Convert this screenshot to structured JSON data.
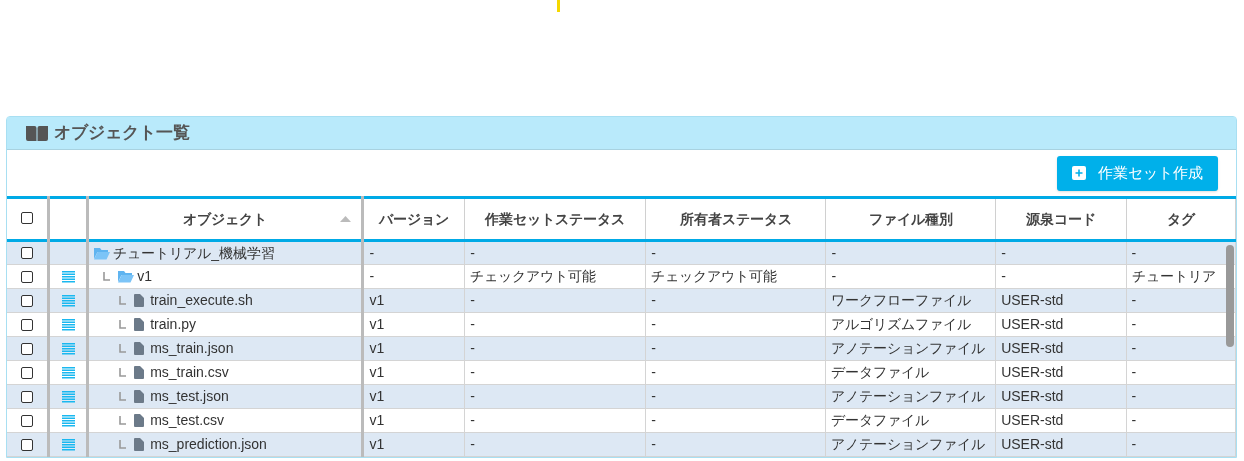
{
  "panel": {
    "title": "オブジェクト一覧"
  },
  "toolbar": {
    "create_button": "作業セット作成"
  },
  "table": {
    "select_all": {
      "checked": false
    },
    "columns": [
      {
        "label": "オブジェクト",
        "sortable": true
      },
      {
        "label": "バージョン",
        "sortable": false
      },
      {
        "label": "作業セットステータス",
        "sortable": false
      },
      {
        "label": "所有者ステータス",
        "sortable": false
      },
      {
        "label": "ファイル種別",
        "sortable": false
      },
      {
        "label": "源泉コード",
        "sortable": false
      },
      {
        "label": "タグ",
        "sortable": false
      }
    ],
    "rows": [
      {
        "kind": "folder",
        "checked": false,
        "menu": false,
        "cells": [
          "チュートリアル_機械学習",
          "-",
          "-",
          "-",
          "-",
          "-",
          "-"
        ],
        "children": [
          {
            "kind": "folder",
            "checked": false,
            "menu": true,
            "cells": [
              "v1",
              "-",
              "チェックアウト可能",
              "チェックアウト可能",
              "-",
              "-",
              "チュートリア"
            ],
            "children": [
              {
                "kind": "file",
                "checked": false,
                "menu": true,
                "cells": [
                  "train_execute.sh",
                  "v1",
                  "-",
                  "-",
                  "ワークフローファイル",
                  "USER-std",
                  "-"
                ]
              },
              {
                "kind": "file",
                "checked": false,
                "menu": true,
                "cells": [
                  "train.py",
                  "v1",
                  "-",
                  "-",
                  "アルゴリズムファイル",
                  "USER-std",
                  "-"
                ]
              },
              {
                "kind": "file",
                "checked": false,
                "menu": true,
                "cells": [
                  "ms_train.json",
                  "v1",
                  "-",
                  "-",
                  "アノテーションファイル",
                  "USER-std",
                  "-"
                ]
              },
              {
                "kind": "file",
                "checked": false,
                "menu": true,
                "cells": [
                  "ms_train.csv",
                  "v1",
                  "-",
                  "-",
                  "データファイル",
                  "USER-std",
                  "-"
                ]
              },
              {
                "kind": "file",
                "checked": false,
                "menu": true,
                "cells": [
                  "ms_test.json",
                  "v1",
                  "-",
                  "-",
                  "アノテーションファイル",
                  "USER-std",
                  "-"
                ]
              },
              {
                "kind": "file",
                "checked": false,
                "menu": true,
                "cells": [
                  "ms_test.csv",
                  "v1",
                  "-",
                  "-",
                  "データファイル",
                  "USER-std",
                  "-"
                ]
              },
              {
                "kind": "file",
                "checked": false,
                "menu": true,
                "cells": [
                  "ms_prediction.json",
                  "v1",
                  "-",
                  "-",
                  "アノテーションファイル",
                  "USER-std",
                  "-"
                ]
              }
            ]
          }
        ]
      }
    ]
  }
}
